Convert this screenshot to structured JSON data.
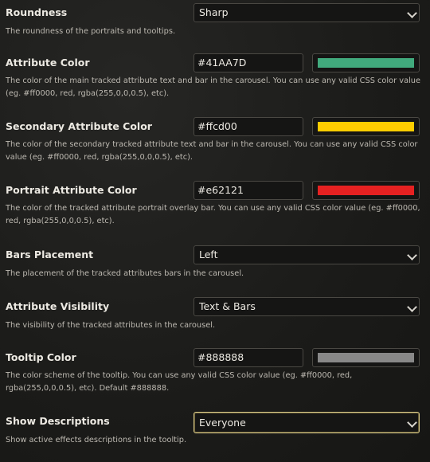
{
  "settings": {
    "roundness": {
      "label": "Roundness",
      "value": "Sharp",
      "description": "The roundness of the portraits and tooltips."
    },
    "attribute_color": {
      "label": "Attribute Color",
      "value": "#41AA7D",
      "swatch": "#41AA7D",
      "description": "The color of the main tracked attribute text and bar in the carousel. You can use any valid CSS color value (eg. #ff0000, red, rgba(255,0,0,0.5), etc)."
    },
    "secondary_attribute_color": {
      "label": "Secondary Attribute Color",
      "value": "#ffcd00",
      "swatch": "#ffcd00",
      "description": "The color of the secondary tracked attribute text and bar in the carousel. You can use any valid CSS color value (eg. #ff0000, red, rgba(255,0,0,0.5), etc)."
    },
    "portrait_attribute_color": {
      "label": "Portrait Attribute Color",
      "value": "#e62121",
      "swatch": "#e62121",
      "description": "The color of the tracked attribute portrait overlay bar. You can use any valid CSS color value (eg. #ff0000, red, rgba(255,0,0,0.5), etc)."
    },
    "bars_placement": {
      "label": "Bars Placement",
      "value": "Left",
      "description": "The placement of the tracked attributes bars in the carousel."
    },
    "attribute_visibility": {
      "label": "Attribute Visibility",
      "value": "Text & Bars",
      "description": "The visibility of the tracked attributes in the carousel."
    },
    "tooltip_color": {
      "label": "Tooltip Color",
      "value": "#888888",
      "swatch": "#888888",
      "description": "The color scheme of the tooltip. You can use any valid CSS color value (eg. #ff0000, red, rgba(255,0,0,0.5), etc). Default #888888."
    },
    "show_descriptions": {
      "label": "Show Descriptions",
      "value": "Everyone",
      "description": "Show active effects descriptions in the tooltip."
    }
  }
}
